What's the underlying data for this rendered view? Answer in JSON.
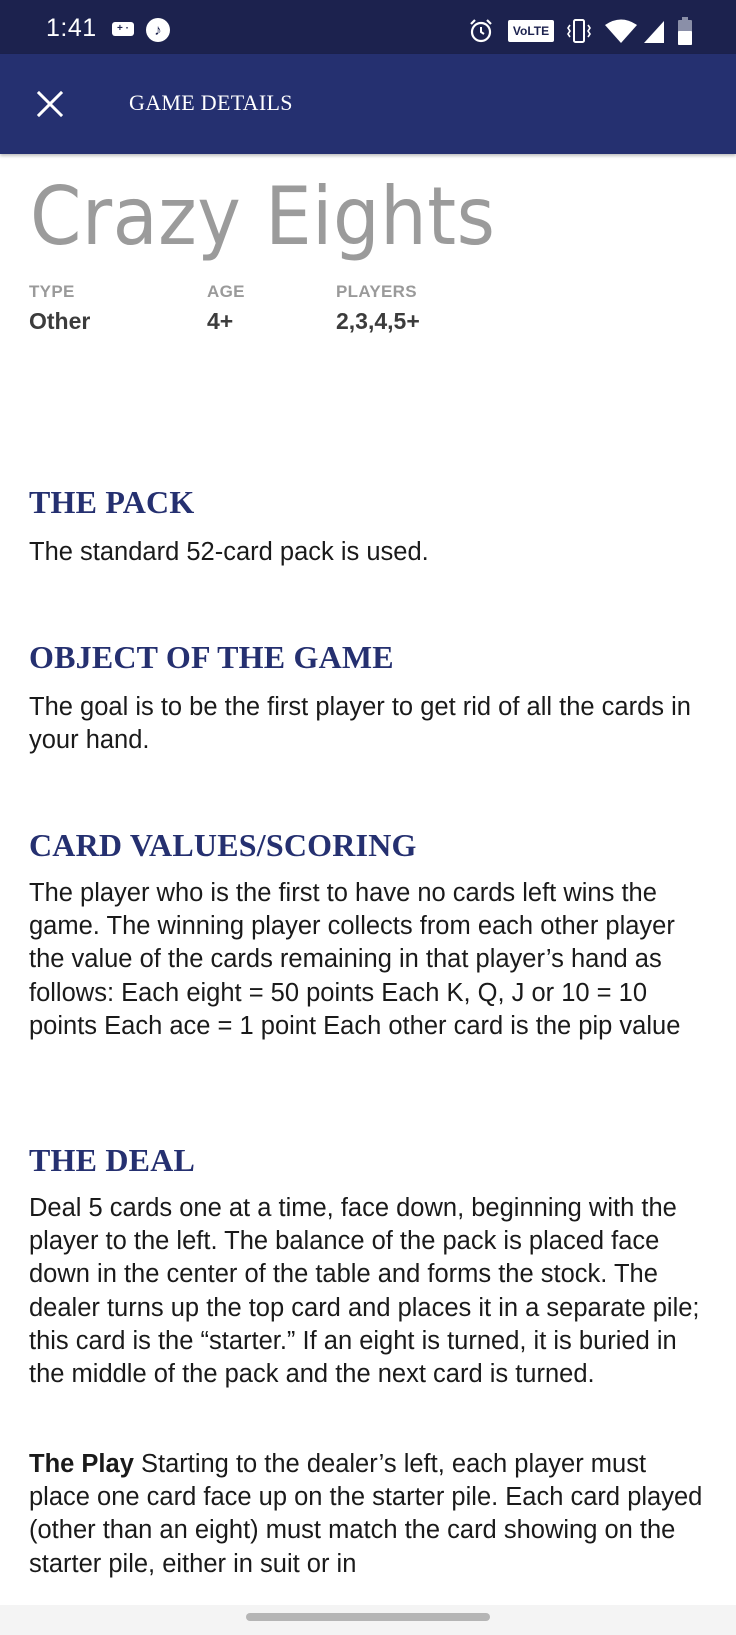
{
  "status_bar": {
    "time": "1:41",
    "volte_label": "VoLTE",
    "icons": [
      "gamepad-icon",
      "music-note-icon",
      "alarm-icon",
      "volte-icon",
      "vibrate-icon",
      "wifi-icon",
      "cell-signal-icon",
      "battery-icon"
    ],
    "colors": {
      "background": "#1c224e"
    }
  },
  "app_bar": {
    "title": "GAME DETAILS",
    "close_icon": "close-icon",
    "colors": {
      "background": "#253070"
    }
  },
  "game": {
    "title": "Crazy Eights",
    "meta": [
      {
        "label": "TYPE",
        "value": "Other"
      },
      {
        "label": "AGE",
        "value": "4+"
      },
      {
        "label": "PLAYERS",
        "value": "2,3,4,5+"
      }
    ]
  },
  "sections": [
    {
      "heading": "THE PACK",
      "body": "The standard 52-card pack is used."
    },
    {
      "heading": "OBJECT OF THE GAME",
      "body": "The goal is to be the first player to get rid of all the cards in your hand."
    },
    {
      "heading": "CARD VALUES/SCORING",
      "body": "The player who is the first to have no cards left wins the game. The winning player collects from each other player the value of the cards remaining in that player’s hand as follows: Each eight = 50 points Each K, Q, J or 10 = 10 points Each ace = 1 point Each other card is the pip value"
    },
    {
      "heading": "THE DEAL",
      "body": "Deal 5 cards one at a time, face down, beginning with the player to the left. The balance of the pack is placed face down in the center of the table and forms the stock. The dealer turns up the top card and places it in a separate pile; this card is the “starter.” If an eight is turned, it is buried in the middle of the pack and the next card is turned.",
      "play_label": "The Play",
      "play_body": " Starting to the dealer’s left, each player must place one card face up on the starter pile. Each card played (other than an eight) must match the card showing on the starter pile, either in suit or in"
    }
  ],
  "colors": {
    "heading": "#253070",
    "title": "#9b9b9b",
    "body_text": "#1a1a1a"
  }
}
